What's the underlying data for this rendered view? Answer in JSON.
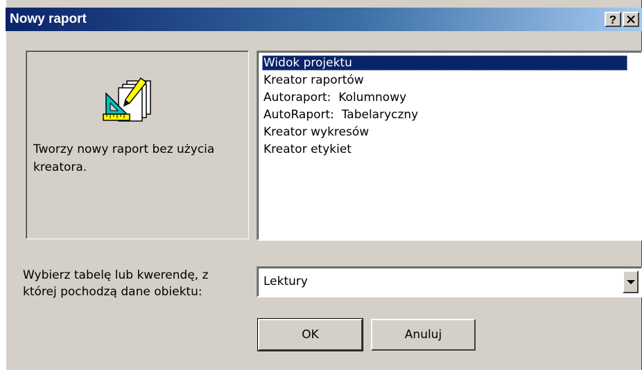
{
  "dialog": {
    "title": "Nowy raport",
    "help_label": "?",
    "close_label": "✕"
  },
  "preview": {
    "icon": "report-design-icon",
    "description": "Tworzy nowy raport bez użycia kreatora."
  },
  "options": {
    "items": [
      "Widok projektu",
      "Kreator raportów",
      "Autoraport:  Kolumnowy",
      "AutoRaport:  Tabelaryczny",
      "Kreator wykresów",
      "Kreator etykiet"
    ],
    "selected_index": 0
  },
  "source": {
    "label": "Wybierz tabelę lub kwerendę, z której pochodzą dane obiektu:",
    "value": "Lektury",
    "dropdown_icon": "chevron-down-icon"
  },
  "buttons": {
    "ok": "OK",
    "cancel": "Anuluj"
  },
  "colors": {
    "title_gradient_start": "#0a246a",
    "title_gradient_end": "#a6caf0",
    "selection": "#0a246a",
    "face": "#d4d0c8"
  }
}
